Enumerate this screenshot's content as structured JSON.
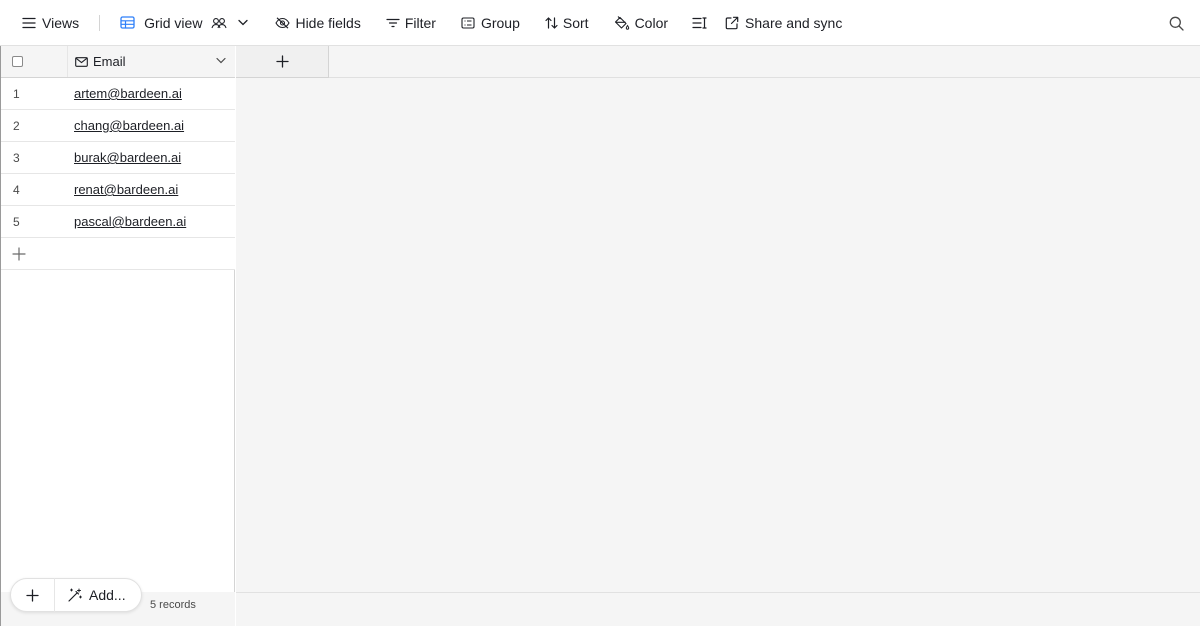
{
  "toolbar": {
    "views_label": "Views",
    "grid_view_label": "Grid view",
    "hide_fields_label": "Hide fields",
    "filter_label": "Filter",
    "group_label": "Group",
    "sort_label": "Sort",
    "color_label": "Color",
    "share_label": "Share and sync"
  },
  "table": {
    "field_header": "Email",
    "rows": [
      {
        "num": "1",
        "email": "artem@bardeen.ai"
      },
      {
        "num": "2",
        "email": "chang@bardeen.ai"
      },
      {
        "num": "3",
        "email": "burak@bardeen.ai"
      },
      {
        "num": "4",
        "email": "renat@bardeen.ai"
      },
      {
        "num": "5",
        "email": "pascal@bardeen.ai"
      }
    ]
  },
  "footer": {
    "add_label": "Add...",
    "records": "5 records"
  },
  "icons": {
    "menu": "menu-icon",
    "grid": "grid-icon",
    "collaborators": "people-icon",
    "hide": "eye-off-icon",
    "filter": "filter-icon",
    "group": "group-icon",
    "sort": "sort-icon",
    "color": "paint-bucket-icon",
    "row_height": "row-height-icon",
    "share": "external-link-icon",
    "search": "search-icon",
    "email": "mail-icon"
  },
  "colors": {
    "accent": "#3fb5c4",
    "grid_icon": "#2d7ff9",
    "background": "#f5f5f5"
  }
}
